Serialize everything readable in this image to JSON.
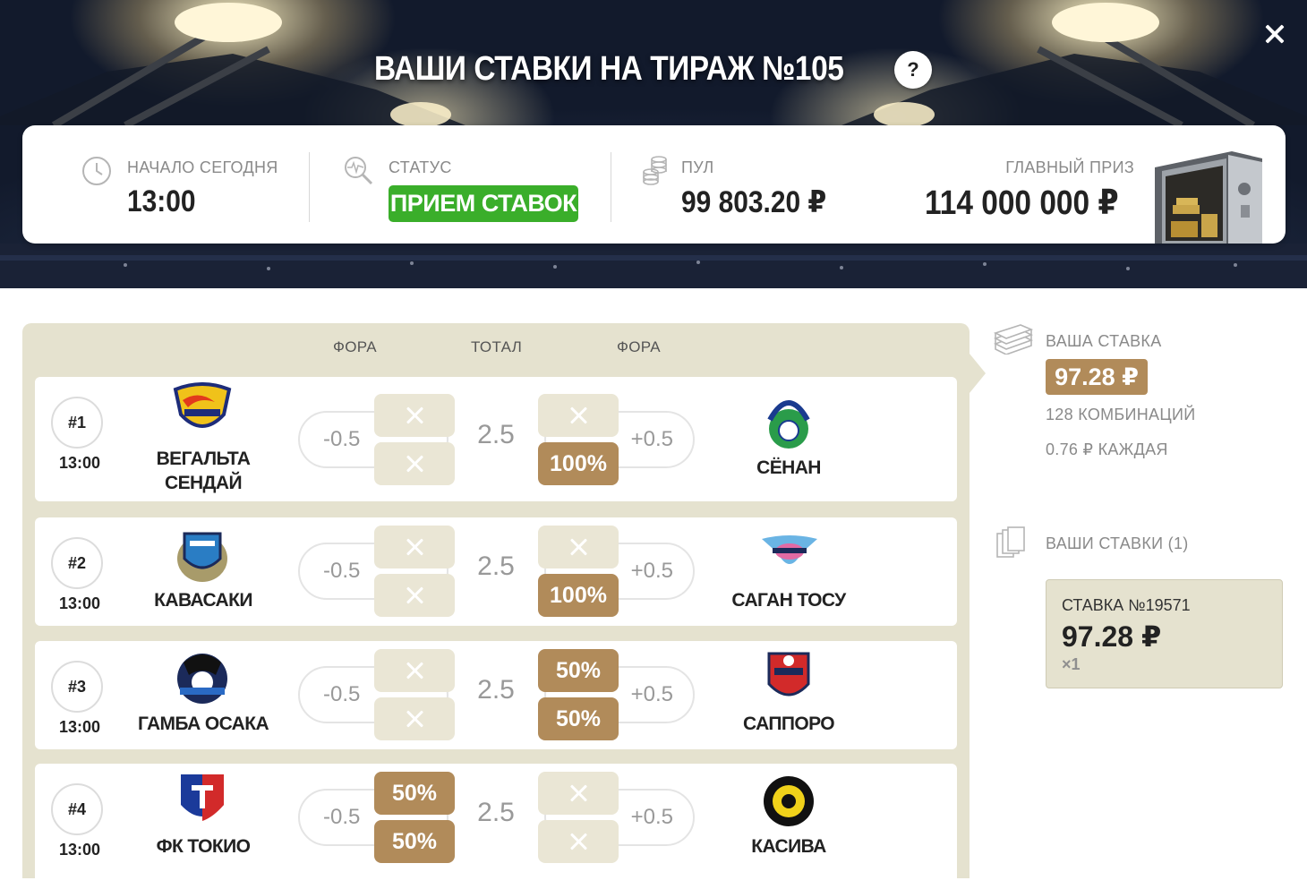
{
  "header": {
    "title": "ВАШИ СТАВКИ НА ТИРАЖ №105",
    "help_label": "?"
  },
  "info": {
    "start_label": "НАЧАЛО СЕГОДНЯ",
    "start_time": "13:00",
    "status_label": "СТАТУС",
    "status_value": "ПРИЕМ СТАВОК",
    "pool_label": "ПУЛ",
    "pool_value": "99 803.20 ₽",
    "prize_label": "ГЛАВНЫЙ ПРИЗ",
    "prize_value": "114 000 000 ₽"
  },
  "columns": [
    "ФОРА",
    "ТОТАЛ",
    "ФОРА"
  ],
  "matches": [
    {
      "number": "#1",
      "time": "13:00",
      "home": "ВЕГАЛЬТА СЕНДАЙ",
      "away": "СЁНАН",
      "home_handicap": "-0.5",
      "total": "2.5",
      "away_handicap": "+0.5",
      "home_top": "",
      "home_bottom": "",
      "away_top": "",
      "away_bottom": "100%"
    },
    {
      "number": "#2",
      "time": "13:00",
      "home": "КАВАСАКИ",
      "away": "САГАН ТОСУ",
      "home_handicap": "-0.5",
      "total": "2.5",
      "away_handicap": "+0.5",
      "home_top": "",
      "home_bottom": "",
      "away_top": "",
      "away_bottom": "100%"
    },
    {
      "number": "#3",
      "time": "13:00",
      "home": "ГАМБА ОСАКА",
      "away": "САППОРО",
      "home_handicap": "-0.5",
      "total": "2.5",
      "away_handicap": "+0.5",
      "home_top": "",
      "home_bottom": "",
      "away_top": "50%",
      "away_bottom": "50%"
    },
    {
      "number": "#4",
      "time": "13:00",
      "home": "ФК ТОКИО",
      "away": "КАСИВА",
      "home_handicap": "-0.5",
      "total": "2.5",
      "away_handicap": "+0.5",
      "home_top": "50%",
      "home_bottom": "50%",
      "away_top": "",
      "away_bottom": ""
    }
  ],
  "sidebar": {
    "stake_label": "ВАША СТАВКА",
    "stake_value": "97.28 ₽",
    "combinations": "128 КОМБИНАЦИЙ",
    "each": "0.76 ₽ КАЖДАЯ",
    "bets_label": "ВАШИ СТАВКИ (1)",
    "bet": {
      "title": "СТАВКА №19571",
      "amount": "97.28 ₽",
      "multiplier": "×1"
    }
  },
  "colors": {
    "status_green": "#3aae2a",
    "accent_brown": "#b18b5a",
    "panel_beige": "#e5e2cf"
  }
}
